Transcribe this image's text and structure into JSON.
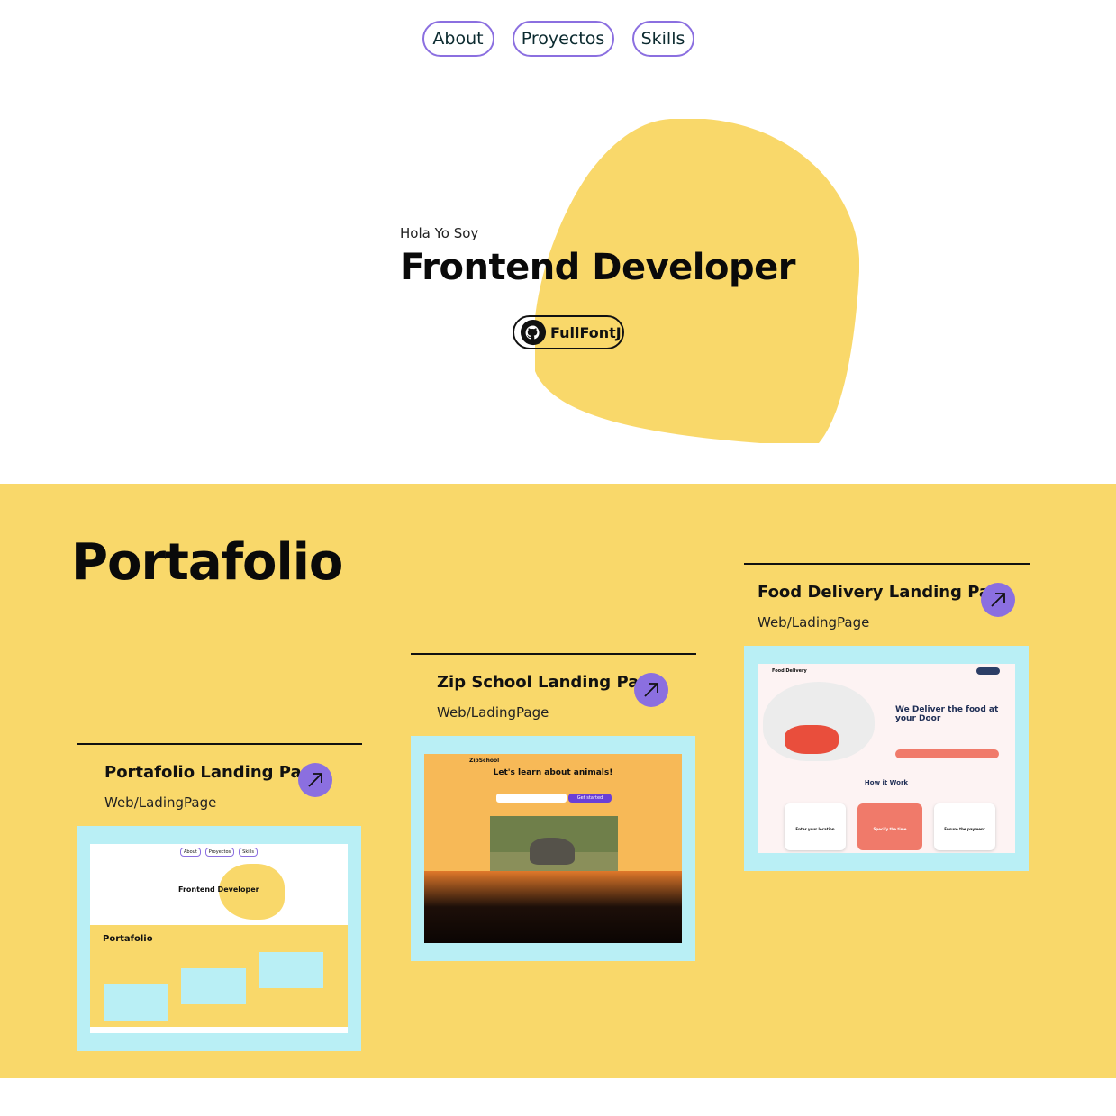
{
  "nav": {
    "items": [
      {
        "label": "About"
      },
      {
        "label": "Proyectos"
      },
      {
        "label": "Skills"
      }
    ]
  },
  "hero": {
    "greeting": "Hola Yo Soy",
    "title": "Frontend Developer",
    "github_label": "FullFontJ",
    "blob_color": "#f9d86a"
  },
  "portfolio": {
    "title": "Portafolio",
    "background": "#f9d86a",
    "accent": "#8b6fe0",
    "cards": [
      {
        "name": "Portafolio Landing Page",
        "tag": "Web/LadingPage",
        "thumb": {
          "nav": [
            "About",
            "Proyectos",
            "Skills"
          ],
          "title": "Frontend Developer",
          "section": "Portafolio"
        }
      },
      {
        "name": "Zip School Landing Page",
        "tag": "Web/LadingPage",
        "thumb": {
          "brand": "ZipSchool",
          "headline": "Let's learn about animals!",
          "cta": "Get started"
        }
      },
      {
        "name": "Food Delivery Landing Page",
        "tag": "Web/LadingPage",
        "thumb": {
          "brand": "Food Delivery",
          "headline": "We Deliver the food at your Door",
          "section": "How it Work",
          "steps": [
            "Enter your location",
            "Specify the time",
            "Ensure the payment"
          ]
        }
      }
    ]
  }
}
